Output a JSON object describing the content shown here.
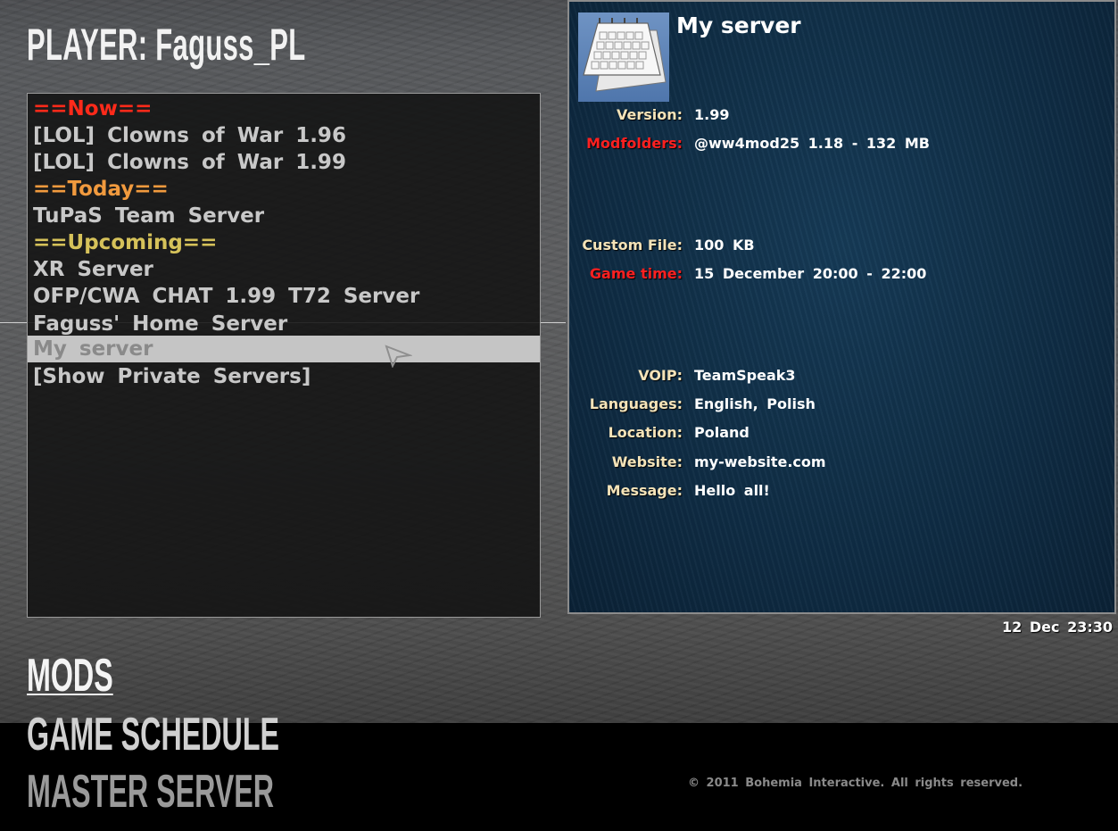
{
  "player": {
    "title": "PLAYER: Faguss_PL"
  },
  "server_list": {
    "items": [
      {
        "label": "==Now==",
        "kind": "now"
      },
      {
        "label": "[LOL] Clowns of War 1.96",
        "kind": "server"
      },
      {
        "label": "[LOL] Clowns of War 1.99",
        "kind": "server"
      },
      {
        "label": "==Today==",
        "kind": "today"
      },
      {
        "label": "TuPaS Team Server",
        "kind": "server"
      },
      {
        "label": "==Upcoming==",
        "kind": "upcoming"
      },
      {
        "label": "XR Server",
        "kind": "server"
      },
      {
        "label": "OFP/CWA CHAT 1.99 T72 Server",
        "kind": "server"
      },
      {
        "label": "Faguss' Home Server",
        "kind": "server"
      },
      {
        "label": "My server",
        "kind": "selected"
      },
      {
        "label": "[Show Private Servers]",
        "kind": "server"
      }
    ]
  },
  "details": {
    "title": "My server",
    "icon": "calendar-icon",
    "rows": [
      {
        "label": "Version:",
        "value": "1.99",
        "label_color": "#f4e3b8"
      },
      {
        "label": "Modfolders:",
        "value": "@ww4mod25 1.18 - 132 MB",
        "label_color": "#ff2020"
      },
      {
        "label": "Custom File:",
        "value": "100 KB",
        "label_color": "#f4e3b8"
      },
      {
        "label": "Game time:",
        "value": "15 December 20:00 - 22:00",
        "label_color": "#ff2020"
      },
      {
        "label": "VOIP:",
        "value": "TeamSpeak3",
        "label_color": "#f4e3b8"
      },
      {
        "label": "Languages:",
        "value": "English, Polish",
        "label_color": "#f4e3b8"
      },
      {
        "label": "Location:",
        "value": "Poland",
        "label_color": "#f4e3b8"
      },
      {
        "label": "Website:",
        "value": "my-website.com",
        "label_color": "#f4e3b8"
      },
      {
        "label": "Message:",
        "value": "Hello all!",
        "label_color": "#f4e3b8"
      }
    ]
  },
  "clock": "12 Dec 23:30",
  "menu": {
    "mods": "MODS",
    "game_schedule": "GAME SCHEDULE",
    "master_server": "MASTER SERVER"
  },
  "copyright": "© 2011 Bohemia Interactive. All rights reserved.",
  "colors": {
    "now": "#ff2a1a",
    "today": "#f19a3e",
    "upcoming": "#d6c25a",
    "panel_blue": "#0f2c44"
  }
}
